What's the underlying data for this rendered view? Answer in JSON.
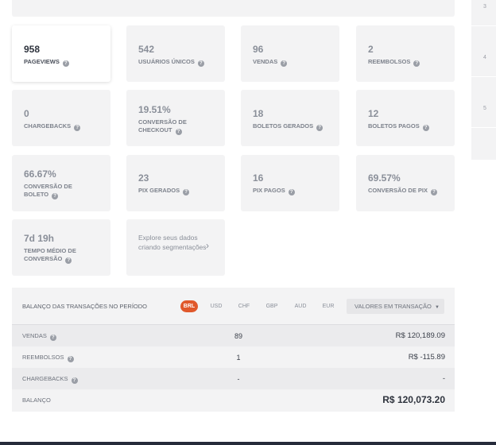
{
  "rail": [
    "3",
    "4",
    "5"
  ],
  "cards": [
    {
      "value": "958",
      "label": "PAGEVIEWS"
    },
    {
      "value": "542",
      "label": "USUÁRIOS ÚNICOS"
    },
    {
      "value": "96",
      "label": "VENDAS"
    },
    {
      "value": "2",
      "label": "REEMBOLSOS"
    },
    {
      "value": "0",
      "label": "CHARGEBACKS"
    },
    {
      "value": "19.51%",
      "label_line1": "CONVERSÃO DE",
      "label_line2": "CHECKOUT"
    },
    {
      "value": "18",
      "label": "BOLETOS GERADOS"
    },
    {
      "value": "12",
      "label": "BOLETOS PAGOS"
    },
    {
      "value": "66.67%",
      "label_line1": "CONVERSÃO DE",
      "label_line2": "BOLETO"
    },
    {
      "value": "23",
      "label": "PIX GERADOS"
    },
    {
      "value": "16",
      "label": "PIX PAGOS"
    },
    {
      "value": "69.57%",
      "label": "CONVERSÃO DE PIX"
    },
    {
      "value": "7d 19h",
      "label_line1": "TEMPO MÉDIO DE",
      "label_line2": "CONVERSÃO"
    }
  ],
  "explore": {
    "text": "Explore seus dados criando segmentações"
  },
  "balance": {
    "title": "BALANÇO DAS TRANSAÇÕES NO PERÍODO",
    "currencies": [
      "BRL",
      "USD",
      "CHF",
      "GBP",
      "AUD",
      "EUR"
    ],
    "selected_currency": "BRL",
    "values_dropdown": "VALORES EM TRANSAÇÃO",
    "rows": [
      {
        "label": "VENDAS",
        "count": "89",
        "amount": "R$ 120,189.09"
      },
      {
        "label": "REEMBOLSOS",
        "count": "1",
        "amount": "R$ -115.89"
      },
      {
        "label": "CHARGEBACKS",
        "count": "-",
        "amount": "-"
      },
      {
        "label": "BALANÇO",
        "count": "",
        "amount": "R$ 120,073.20"
      }
    ]
  },
  "colors": {
    "accent": "#e0582b",
    "card_bg": "#f3f3f4",
    "footer": "#262b3a"
  }
}
